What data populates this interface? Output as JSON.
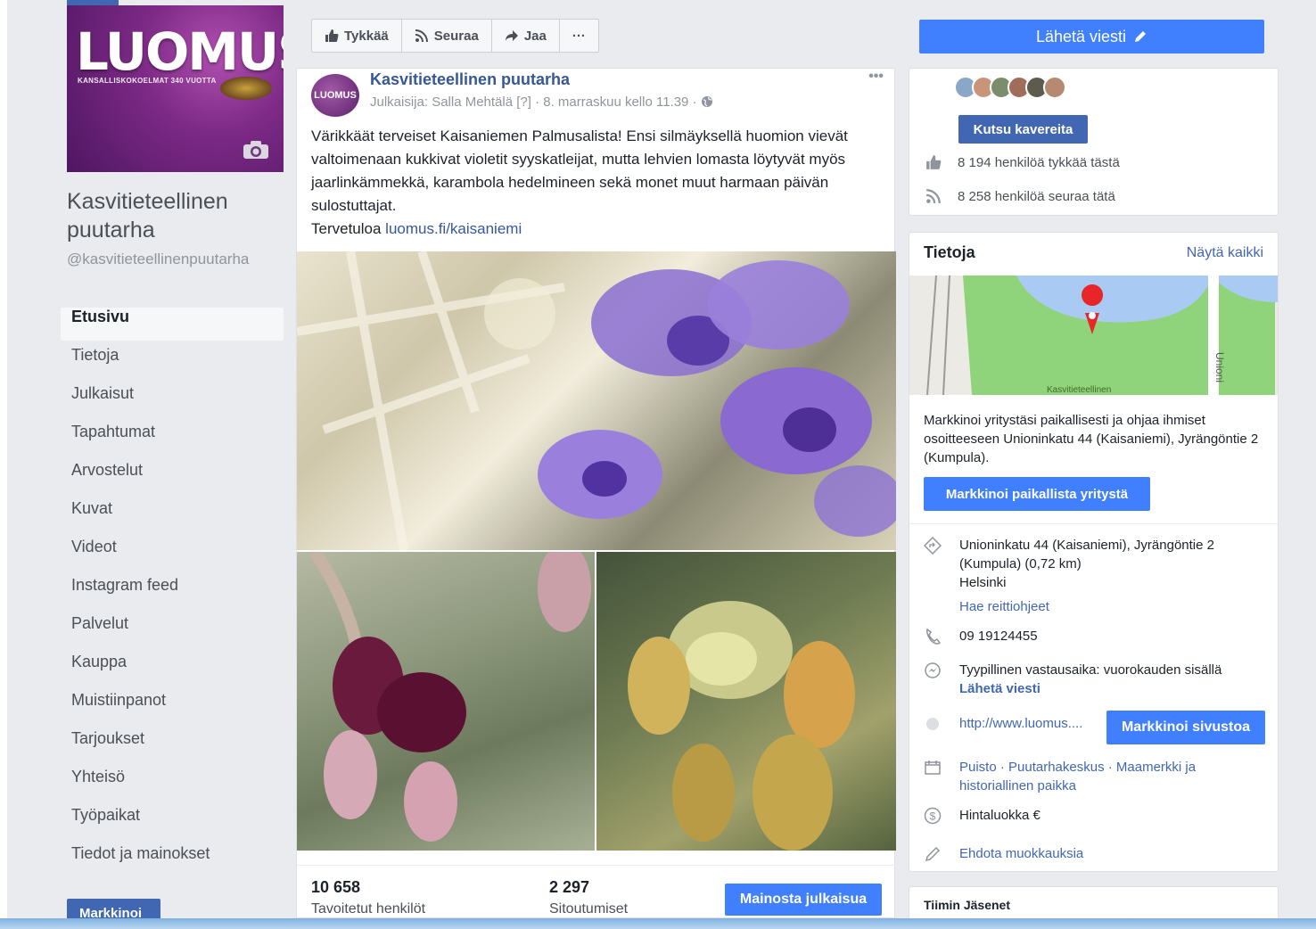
{
  "cover": {
    "logo_text": "LUOMUS",
    "tagline": "KANSALLISKOKOELMAT 340 VUOTTA"
  },
  "page": {
    "name": "Kasvitieteellinen puutarha",
    "handle": "@kasvitieteellinenpuutarha"
  },
  "nav": {
    "items": [
      "Etusivu",
      "Tietoja",
      "Julkaisut",
      "Tapahtumat",
      "Arvostelut",
      "Kuvat",
      "Videot",
      "Instagram feed",
      "Palvelut",
      "Kauppa",
      "Muistiinpanot",
      "Tarjoukset",
      "Yhteisö",
      "Työpaikat",
      "Tiedot ja mainokset"
    ],
    "active": "Etusivu",
    "promote_label": "Markkinoi"
  },
  "actions": {
    "like": "Tykkää",
    "follow": "Seuraa",
    "share": "Jaa",
    "more": "···",
    "send_message": "Lähetä viesti"
  },
  "post": {
    "avatar_text": "LUOMUS",
    "author": "Kasvitieteellinen puutarha",
    "meta": "Julkaisija: Salla Mehtälä [?] · 8. marraskuu kello 11.39 ·",
    "more": "•••",
    "text": "Värikkäät terveiset Kaisaniemen Palmusalista! Ensi silmäyksellä huomion vievät valtoimenaan kukkivat violetit syyskatleijat, mutta lehvien lomasta löytyvät myös jaarlinkämmekkä, karambola hedelmineen sekä monet muut harmaan päivän sulostuttajat.",
    "welcome": "Tervetuloa",
    "link": "luomus.fi/kaisaniemi",
    "reach_value": "10 658",
    "reach_label": "Tavoitetut henkilöt",
    "engagement_value": "2 297",
    "engagement_label": "Sitoutumiset",
    "boost_label": "Mainosta julkaisua"
  },
  "community": {
    "invite_label": "Kutsu kavereita",
    "likes_text": "8 194 henkilöä tykkää tästä",
    "follows_text": "8 258 henkilöä seuraa tätä"
  },
  "about": {
    "title": "Tietoja",
    "see_all": "Näytä kaikki",
    "map_label": "Kasvitieteellinen",
    "map_street": "Unioni",
    "ad_text": "Markkinoi yritystäsi paikallisesti ja ohjaa ihmiset osoitteeseen Unioninkatu 44 (Kaisaniemi), Jyrängöntie 2 (Kumpula).",
    "local_btn": "Markkinoi paikallista yritystä",
    "address": "Unioninkatu 44 (Kaisaniemi), Jyrängöntie 2 (Kumpula) (0,72 km)",
    "city": "Helsinki",
    "directions": "Hae reittiohjeet",
    "phone": "09 19124455",
    "response": "Tyypillinen vastausaika: vuorokauden sisällä",
    "send_message": "Lähetä viesti",
    "website": "http://www.luomus....",
    "website_btn": "Markkinoi sivustoa",
    "categories": "Puisto · Puutarhakeskus · Maamerkki ja historiallinen paikka",
    "price": "Hintaluokka €",
    "suggest": "Ehdota muokkauksia"
  },
  "team": {
    "title": "Tiimin Jäsenet"
  },
  "colors": {
    "fb_blue": "#4267b2",
    "button_blue": "#4080ff",
    "link_blue": "#365899",
    "background": "#e9ebee"
  }
}
